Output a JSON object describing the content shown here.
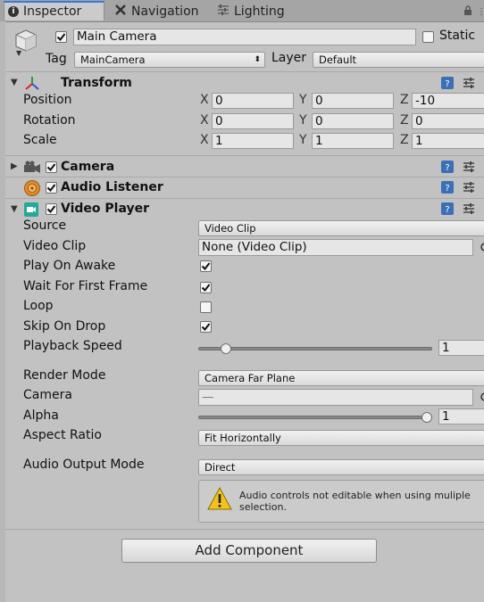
{
  "tabs": {
    "inspector": "Inspector",
    "navigation": "Navigation",
    "lighting": "Lighting"
  },
  "header": {
    "object_name": "Main Camera",
    "static_label": "Static",
    "tag_label": "Tag",
    "tag_value": "MainCamera",
    "layer_label": "Layer",
    "layer_value": "Default"
  },
  "transform": {
    "title": "Transform",
    "position_label": "Position",
    "rotation_label": "Rotation",
    "scale_label": "Scale",
    "axis_x": "X",
    "axis_y": "Y",
    "axis_z": "Z",
    "position": {
      "x": "0",
      "y": "0",
      "z": "-10"
    },
    "rotation": {
      "x": "0",
      "y": "0",
      "z": "0"
    },
    "scale": {
      "x": "1",
      "y": "1",
      "z": "1"
    }
  },
  "components": {
    "camera": "Camera",
    "audio_listener": "Audio Listener",
    "video_player": "Video Player"
  },
  "video_player": {
    "source_label": "Source",
    "source_value": "Video Clip",
    "video_clip_label": "Video Clip",
    "video_clip_value": "None (Video Clip)",
    "play_on_awake_label": "Play On Awake",
    "play_on_awake": true,
    "wait_first_frame_label": "Wait For First Frame",
    "wait_first_frame": true,
    "loop_label": "Loop",
    "loop": false,
    "skip_on_drop_label": "Skip On Drop",
    "skip_on_drop": true,
    "playback_speed_label": "Playback Speed",
    "playback_speed_value": "1",
    "playback_speed_fraction": 0.1,
    "render_mode_label": "Render Mode",
    "render_mode_value": "Camera Far Plane",
    "camera_label": "Camera",
    "camera_value": "—",
    "alpha_label": "Alpha",
    "alpha_value": "1",
    "alpha_fraction": 1.0,
    "aspect_ratio_label": "Aspect Ratio",
    "aspect_ratio_value": "Fit Horizontally",
    "audio_output_label": "Audio Output Mode",
    "audio_output_value": "Direct",
    "warning_text": "Audio controls not editable when using muliple selection."
  },
  "footer": {
    "add_component": "Add Component"
  },
  "colors": {
    "panel_bg": "#c2c2c2",
    "tab_accent": "#3a79d8",
    "help_icon": "#3b6fb6",
    "video_icon": "#23a99b"
  }
}
